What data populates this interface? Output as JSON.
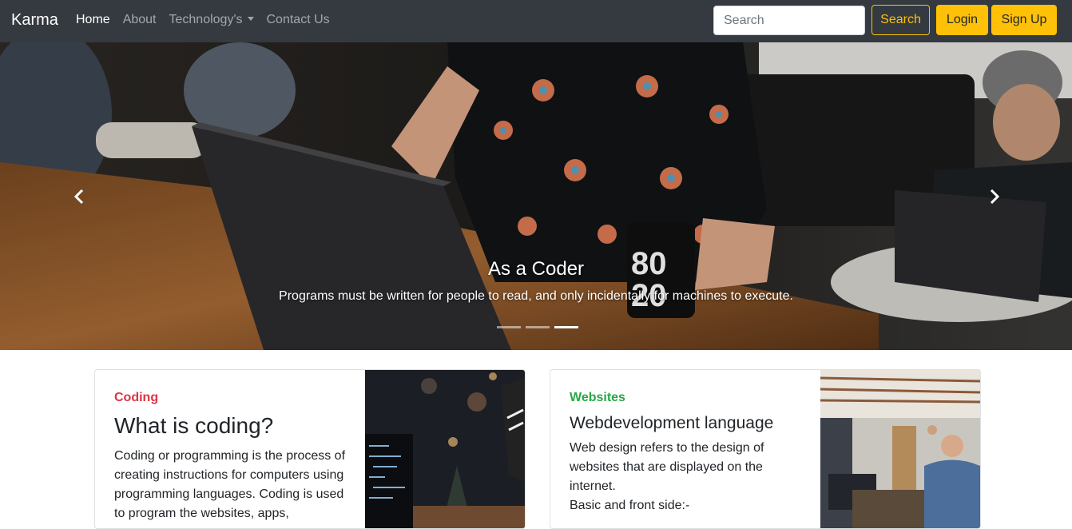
{
  "navbar": {
    "brand": "Karma",
    "links": [
      {
        "label": "Home",
        "active": true
      },
      {
        "label": "About",
        "active": false
      },
      {
        "label": "Technology's",
        "active": false,
        "dropdown": true
      },
      {
        "label": "Contact Us",
        "active": false
      }
    ],
    "search_placeholder": "Search",
    "search_button": "Search",
    "login_button": "Login",
    "signup_button": "Sign Up"
  },
  "carousel": {
    "title": "As a Coder",
    "text": "Programs must be written for people to read, and only incidentally for machines to execute.",
    "prev_icon": "chevron-left-icon",
    "next_icon": "chevron-right-icon",
    "slides_total": 3,
    "active_slide": 3
  },
  "cards": [
    {
      "category": "Coding",
      "title": "What is coding?",
      "text": "Coding or programming is the process of creating instructions for computers using programming languages. Coding is used to program the websites, apps,"
    },
    {
      "category": "Websites",
      "title": "Webdevelopment language",
      "text": "Web design refers to the design of websites that are displayed on the internet.",
      "text2": "Basic and front side:-"
    }
  ],
  "colors": {
    "navbar_bg": "#343a40",
    "accent": "#ffc107",
    "coding_category": "#dc3545",
    "websites_category": "#28a745"
  }
}
